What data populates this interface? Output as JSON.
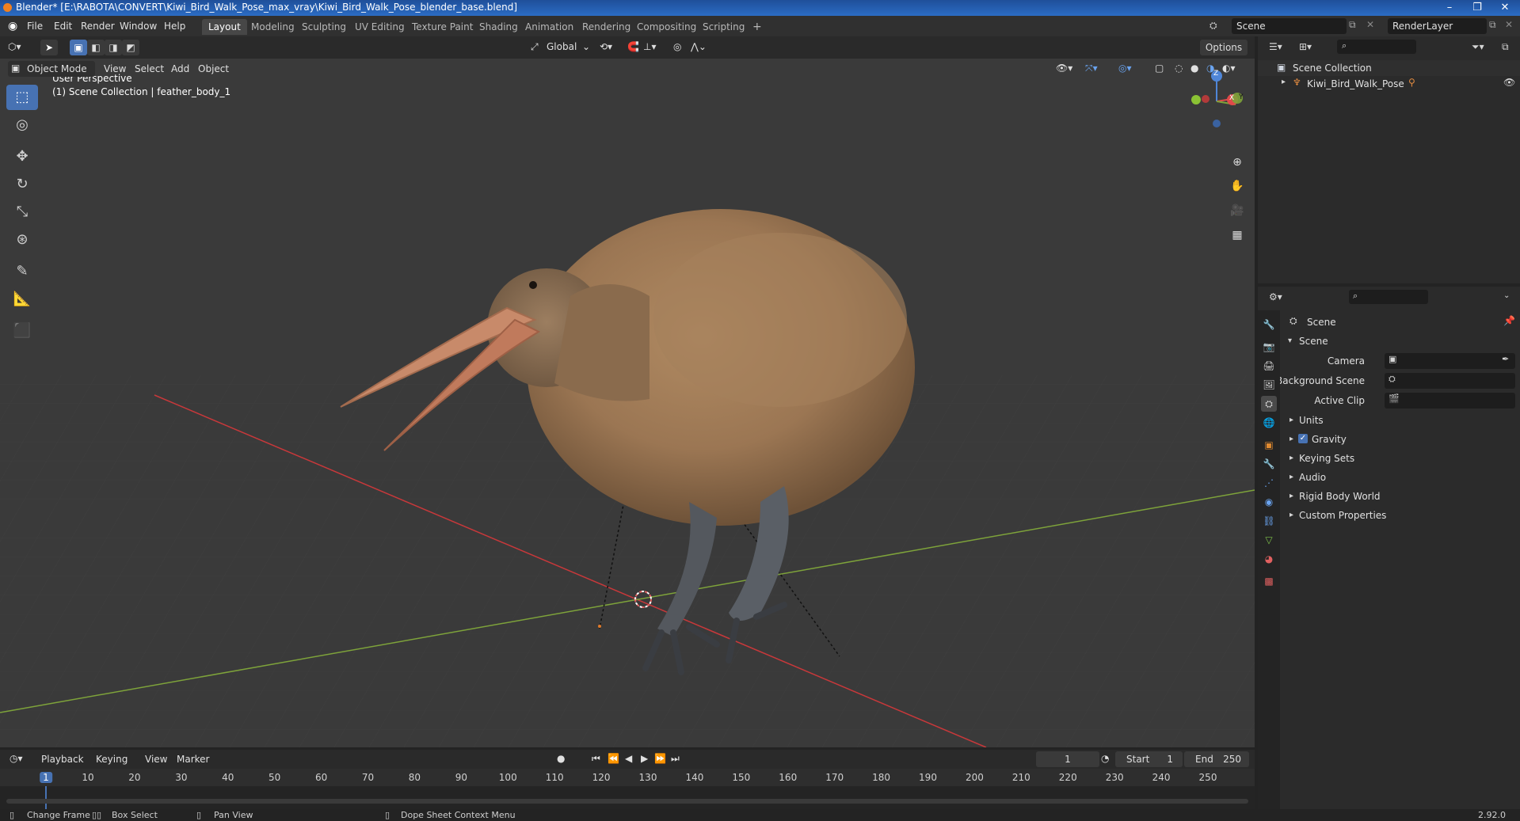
{
  "window": {
    "title": "Blender* [E:\\RABOTA\\CONVERT\\Kiwi_Bird_Walk_Pose_max_vray\\Kiwi_Bird_Walk_Pose_blender_base.blend]",
    "controls": [
      "–",
      "❐",
      "✕"
    ]
  },
  "menu": [
    "File",
    "Edit",
    "Render",
    "Window",
    "Help"
  ],
  "workspaces": [
    {
      "label": "Layout",
      "active": true
    },
    {
      "label": "Modeling"
    },
    {
      "label": "Sculpting"
    },
    {
      "label": "UV Editing"
    },
    {
      "label": "Texture Paint"
    },
    {
      "label": "Shading"
    },
    {
      "label": "Animation"
    },
    {
      "label": "Rendering"
    },
    {
      "label": "Compositing"
    },
    {
      "label": "Scripting"
    }
  ],
  "topbar": {
    "add_workspace": "+",
    "scene": "Scene",
    "view_layer": "RenderLayer"
  },
  "viewport": {
    "transform_orientation": "Global",
    "options": "Options",
    "mode": "Object Mode",
    "header_menus": [
      "View",
      "Select",
      "Add",
      "Object"
    ],
    "overlay_title": "User Perspective",
    "overlay_subtitle": "(1) Scene Collection | feather_body_1",
    "gizmo": {
      "z": "Z",
      "x": "X",
      "y": "Y"
    }
  },
  "outliner": {
    "root": "Scene Collection",
    "items": [
      {
        "label": "Kiwi_Bird_Walk_Pose"
      }
    ]
  },
  "properties": {
    "context": "Scene",
    "panel_title": "Scene",
    "fields": [
      {
        "label": "Camera",
        "value": ""
      },
      {
        "label": "Background Scene",
        "value": ""
      },
      {
        "label": "Active Clip",
        "value": ""
      }
    ],
    "subpanels": [
      {
        "label": "Units",
        "checkbox": false
      },
      {
        "label": "Gravity",
        "checkbox": true
      },
      {
        "label": "Keying Sets",
        "checkbox": false
      },
      {
        "label": "Audio",
        "checkbox": false
      },
      {
        "label": "Rigid Body World",
        "checkbox": false
      },
      {
        "label": "Custom Properties",
        "checkbox": false
      }
    ]
  },
  "timeline": {
    "menus": [
      "Playback",
      "Keying",
      "View",
      "Marker"
    ],
    "current_frame": "1",
    "start_label": "Start",
    "start": "1",
    "end_label": "End",
    "end": "250",
    "ticks": [
      "1",
      "10",
      "20",
      "30",
      "40",
      "50",
      "60",
      "70",
      "80",
      "90",
      "100",
      "110",
      "120",
      "130",
      "140",
      "150",
      "160",
      "170",
      "180",
      "190",
      "200",
      "210",
      "220",
      "230",
      "240",
      "250"
    ]
  },
  "statusbar": {
    "items": [
      "Change Frame",
      "Box Select",
      "Pan View",
      "Dope Sheet Context Menu"
    ],
    "version": "2.92.0"
  },
  "colors": {
    "accent": "#4772b3",
    "x_axis": "#c8383a",
    "y_axis": "#7ea33a",
    "background": "#3a3a3a"
  }
}
